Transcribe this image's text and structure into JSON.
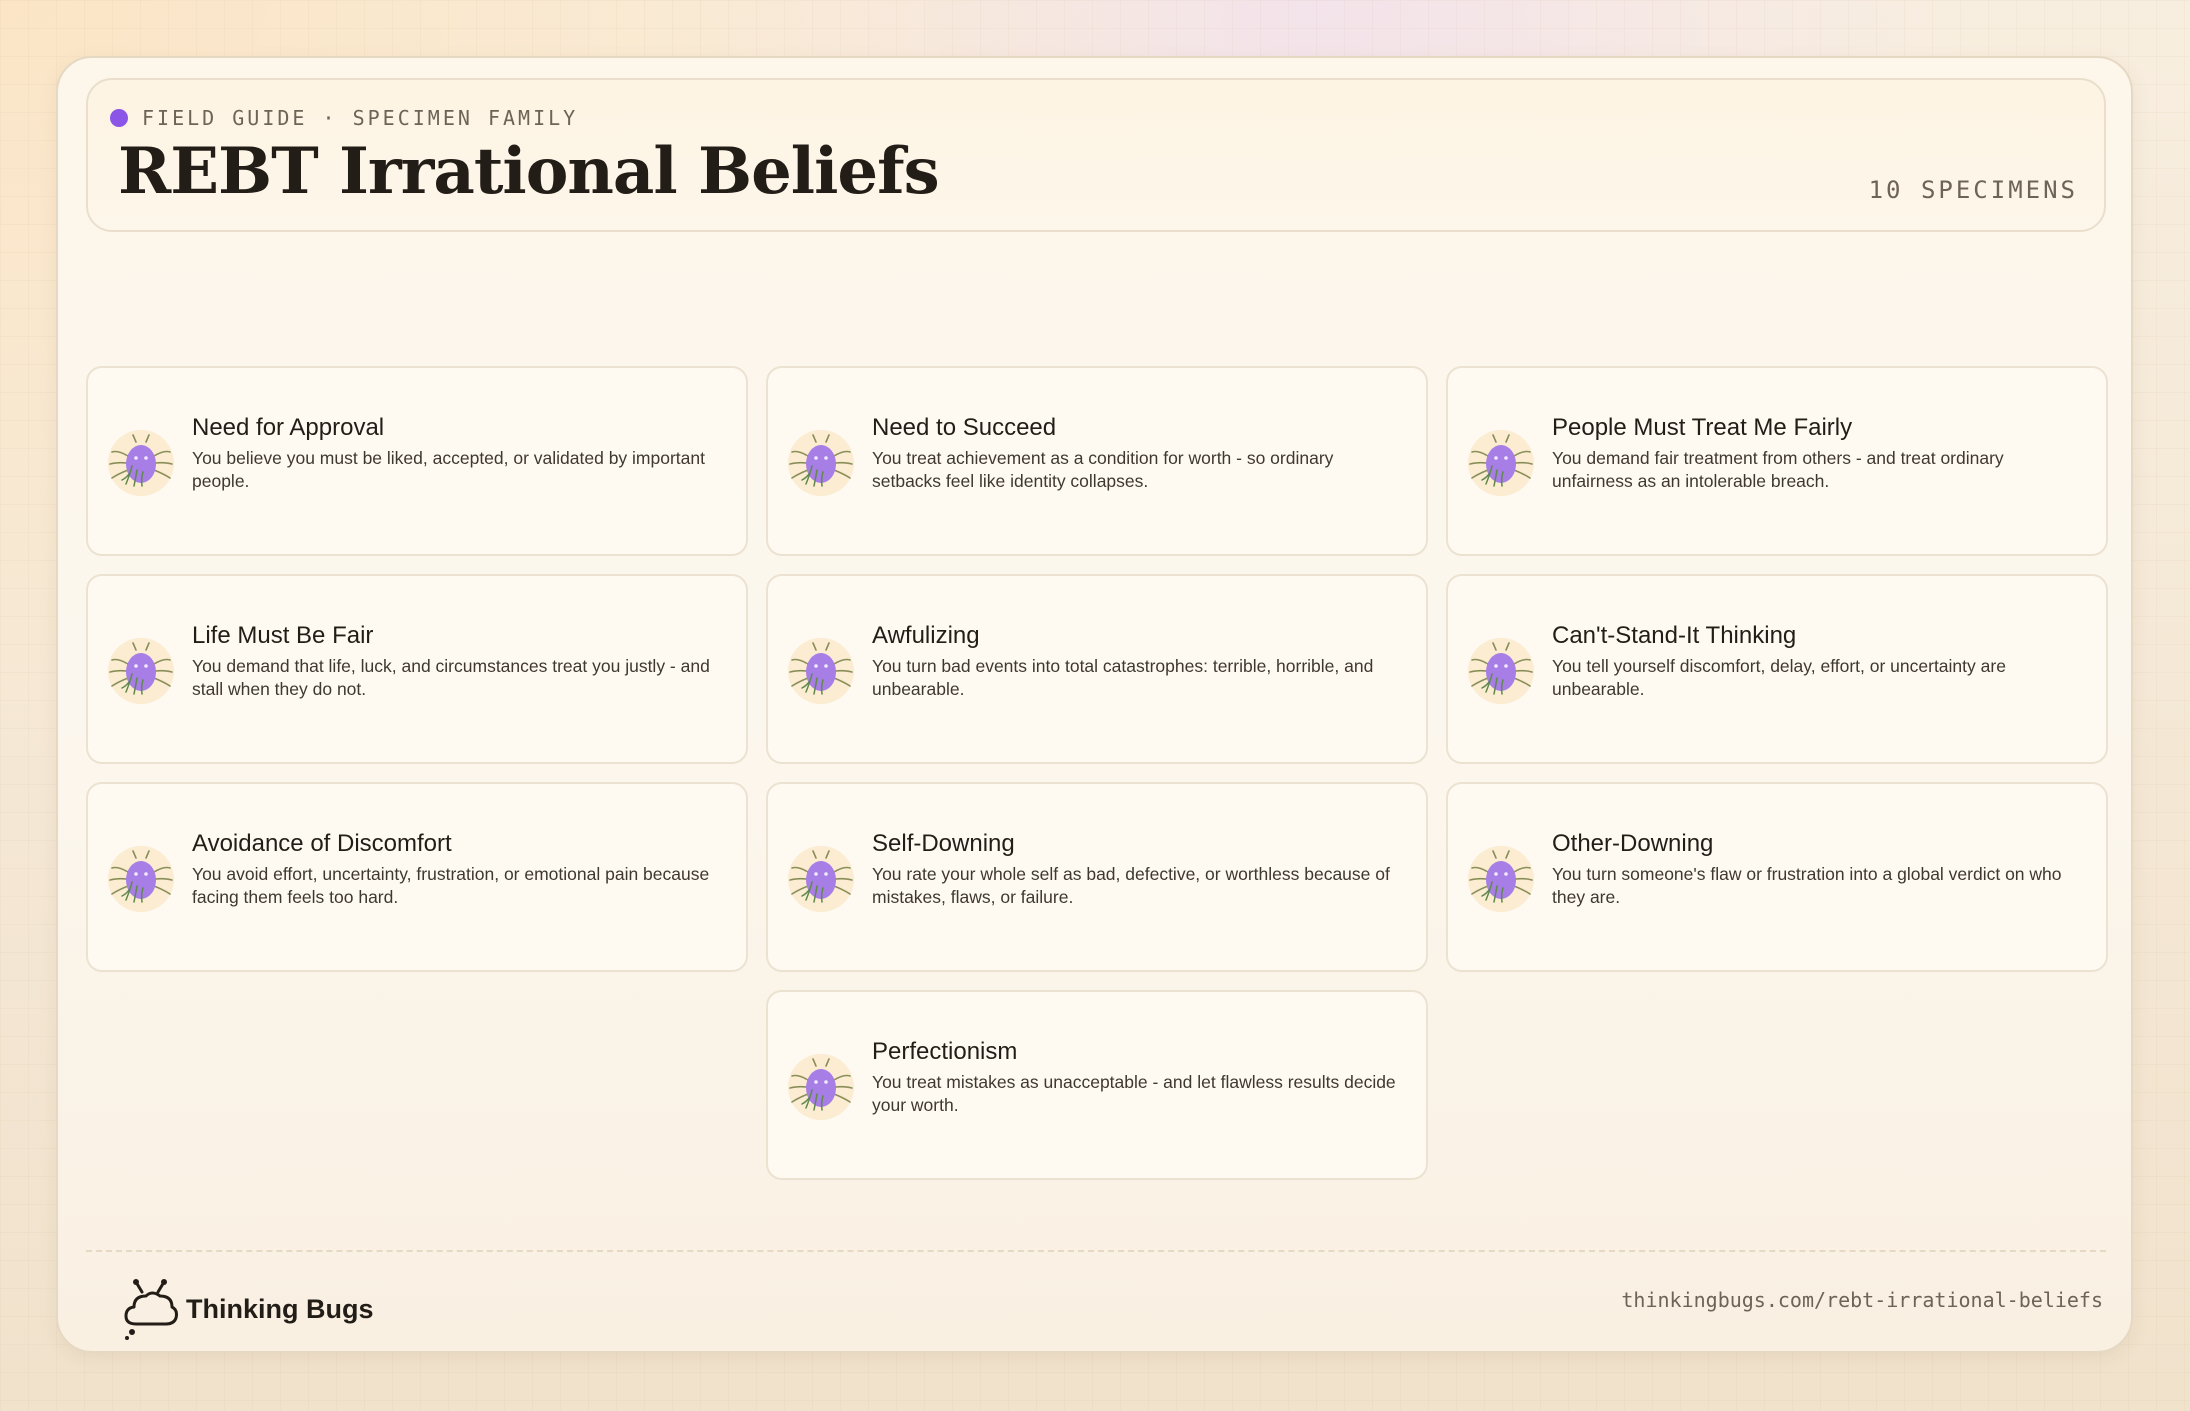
{
  "header": {
    "eyebrow": "FIELD GUIDE · SPECIMEN FAMILY",
    "title": "REBT Irrational Beliefs",
    "count": "10 SPECIMENS"
  },
  "cards": [
    {
      "title": "Need for Approval",
      "description": "You believe you must be liked, accepted, or validated by important people."
    },
    {
      "title": "Need to Succeed",
      "description": "You treat achievement as a condition for worth - so ordinary setbacks feel like identity collapses."
    },
    {
      "title": "People Must Treat Me Fairly",
      "description": "You demand fair treatment from others - and treat ordinary unfairness as an intolerable breach."
    },
    {
      "title": "Life Must Be Fair",
      "description": "You demand that life, luck, and circumstances treat you justly - and stall when they do not."
    },
    {
      "title": "Awfulizing",
      "description": "You turn bad events into total catastrophes: terrible, horrible, and unbearable."
    },
    {
      "title": "Can't-Stand-It Thinking",
      "description": "You tell yourself discomfort, delay, effort, or uncertainty are unbearable."
    },
    {
      "title": "Avoidance of Discomfort",
      "description": "You avoid effort, uncertainty, frustration, or emotional pain because facing them feels too hard."
    },
    {
      "title": "Self-Downing",
      "description": "You rate your whole self as bad, defective, or worthless because of mistakes, flaws, or failure."
    },
    {
      "title": "Other-Downing",
      "description": "You turn someone's flaw or frustration into a global verdict on who they are."
    },
    {
      "title": "Perfectionism",
      "description": "You treat mistakes as unacceptable - and let flawless results decide your worth."
    }
  ],
  "footer": {
    "brand": "Thinking Bugs",
    "url": "thinkingbugs.com/rebt-irrational-beliefs"
  },
  "colors": {
    "accent": "#8b55e8",
    "bug_body": "#a77de6",
    "bug_halo": "#fbecd2",
    "text": "#231d18"
  },
  "icons": {
    "card_icon": "bug-icon",
    "brand_icon": "cloud-bug-logo-icon"
  }
}
